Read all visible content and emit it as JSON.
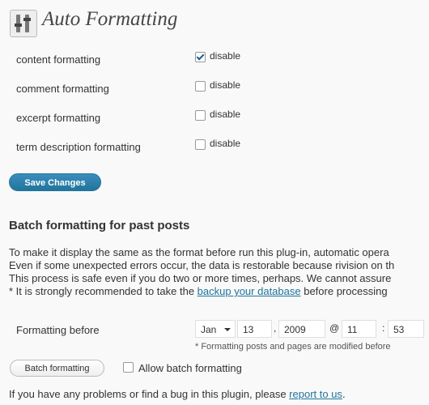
{
  "page_title": "Auto Formatting",
  "options": [
    {
      "label": "content formatting",
      "checkbox_label": "disable",
      "checked": true
    },
    {
      "label": "comment formatting",
      "checkbox_label": "disable",
      "checked": false
    },
    {
      "label": "excerpt formatting",
      "checkbox_label": "disable",
      "checked": false
    },
    {
      "label": "term description formatting",
      "checkbox_label": "disable",
      "checked": false
    }
  ],
  "save_button": "Save Changes",
  "batch": {
    "heading": "Batch formatting for past posts",
    "lines": [
      "To make it display the same as the format before run this plug-in, automatic opera",
      "Even if some unexpected errors occur, the data is restorable because rivision on th",
      "This process is safe even if you do two or more times, perhaps. We cannot assure"
    ],
    "backup_prefix": "* It is strongly recommended to take the ",
    "backup_link": "backup your database",
    "backup_suffix": " before processing",
    "formatting_before_label": "Formatting before",
    "month": "Jan",
    "day": "13",
    "comma": ",",
    "year": "2009",
    "at": "@",
    "hour": "11",
    "colon": ":",
    "minute": "53",
    "note": "* Formatting posts and pages are modified before",
    "batch_button": "Batch formatting",
    "allow_label": "Allow batch formatting",
    "allow_checked": false
  },
  "footer": {
    "prefix": "If you have any problems or find a bug in this plugin, please ",
    "link": "report to us",
    "suffix": "."
  },
  "colors": {
    "primary": "#21759b",
    "link": "#21759b",
    "background": "#f9f9f9"
  }
}
